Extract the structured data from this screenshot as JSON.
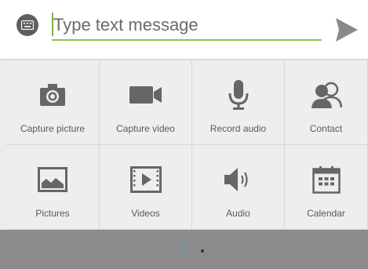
{
  "compose": {
    "placeholder": "Type text message",
    "keyboard_icon": "keyboard-icon",
    "send_icon": "send-icon",
    "accent_color": "#8bc34a"
  },
  "attachments": {
    "items": [
      {
        "label": "Capture picture",
        "icon": "camera-icon"
      },
      {
        "label": "Capture video",
        "icon": "video-camera-icon"
      },
      {
        "label": "Record audio",
        "icon": "microphone-icon"
      },
      {
        "label": "Contact",
        "icon": "contact-icon"
      },
      {
        "label": "Pictures",
        "icon": "picture-icon"
      },
      {
        "label": "Videos",
        "icon": "video-file-icon"
      },
      {
        "label": "Audio",
        "icon": "speaker-icon"
      },
      {
        "label": "Calendar",
        "icon": "calendar-icon"
      }
    ]
  },
  "pager": {
    "active_color": "#4aa3df",
    "inactive_color": "#333333"
  }
}
